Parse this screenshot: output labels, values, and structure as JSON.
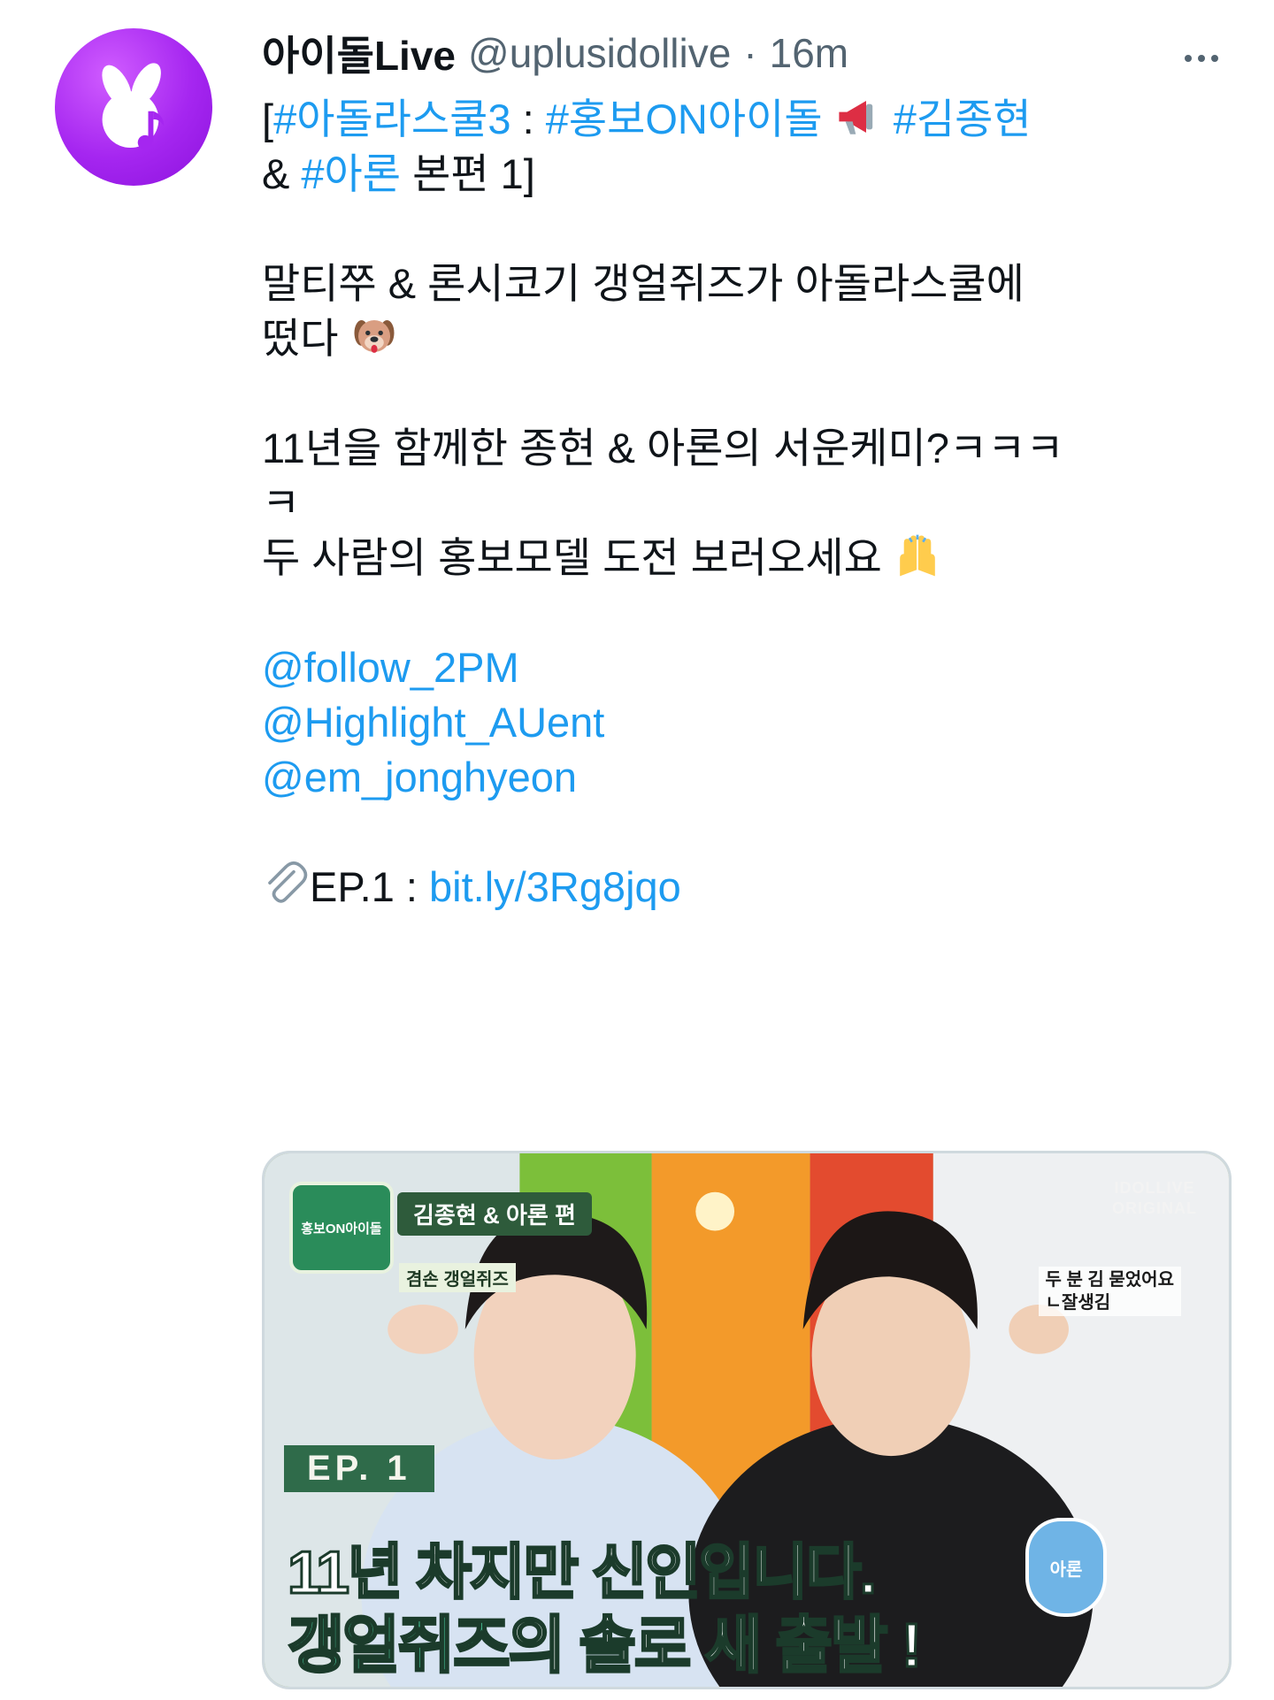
{
  "tweet": {
    "author_name": "아이돌Live",
    "handle": "@uplusidollive",
    "separator": "·",
    "time": "16m",
    "colors": {
      "accent": "#1d9bf0",
      "text": "#0f1419",
      "muted": "#536471",
      "avatar": "#a526f0"
    },
    "icons": {
      "avatar": "rabbit-note-logo",
      "more": "more-horizontal-icon",
      "megaphone": "megaphone-emoji",
      "dog": "dog-face-emoji",
      "hands": "raising-hands-emoji",
      "clip": "paperclip-emoji"
    },
    "body": {
      "l1_open": "[",
      "l1_tag1": "#아돌라스쿨3",
      "l1_colon": " : ",
      "l1_tag2": "#홍보ON아이돌",
      "l1_tag3": "#김종현",
      "l2_amp": "& ",
      "l2_tag": "#아론",
      "l2_rest": " 본편 1]",
      "p2_l1": "말티쭈 & 론시코기 갱얼쥐즈가 아돌라스쿨에",
      "p2_l2": "떴다",
      "p3_l1": "11년을 함께한 종현 & 아론의 서운케미?ㅋㅋㅋ",
      "p3_l2": "ㅋ",
      "p3_l3": "두 사람의 홍보모델 도전 보러오세요",
      "mention1": "@follow_2PM",
      "mention2": "@Highlight_AUent",
      "mention3": "@em_jonghyeon",
      "ep_label": "EP.1 : ",
      "ep_link": "bit.ly/3Rg8jqo"
    },
    "thumbnail": {
      "badge": "홍보ON아이돌",
      "tag": "김종현 & 아론 편",
      "sub": "겸손 갱얼쥐즈",
      "brand_line1": "IDOLLIVE",
      "brand_line2": "ORIGINAL",
      "note_line1": "두 분 김 묻었어요",
      "note_line2": "ㄴ잘생김",
      "ep": "EP. 1",
      "title_line1": "11년 차지만 신인입니다.",
      "title_line2_highlight": "갱얼쥐즈",
      "title_line2_rest": "의 솔로 새 출발 !",
      "name_pin": "아론"
    }
  }
}
